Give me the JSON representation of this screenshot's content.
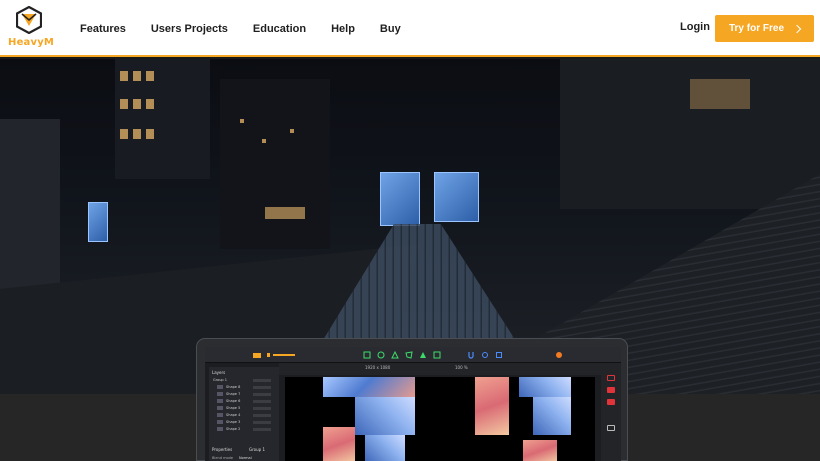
{
  "brand": {
    "name": "HeavyM",
    "accent": "#f5a623"
  },
  "nav": {
    "items": [
      {
        "label": "Features"
      },
      {
        "label": "Users Projects"
      },
      {
        "label": "Education"
      },
      {
        "label": "Help"
      },
      {
        "label": "Buy"
      }
    ],
    "login_label": "Login",
    "cta_label": "Try for Free",
    "cta_icon": "chevron-right-icon"
  },
  "app_preview": {
    "resolution": "1920 x 1080",
    "zoom": "100 %",
    "layers_title": "Layers",
    "layers": [
      {
        "label": "Group 1"
      },
      {
        "label": "Shape 8"
      },
      {
        "label": "Shape 7"
      },
      {
        "label": "Shape 6"
      },
      {
        "label": "Shape 5"
      },
      {
        "label": "Shape 4"
      },
      {
        "label": "Shape 3"
      },
      {
        "label": "Shape 2"
      }
    ],
    "properties_title": "Properties",
    "properties_group": "Group 1",
    "blend_label": "Blend mode",
    "blend_value": "Normal"
  }
}
